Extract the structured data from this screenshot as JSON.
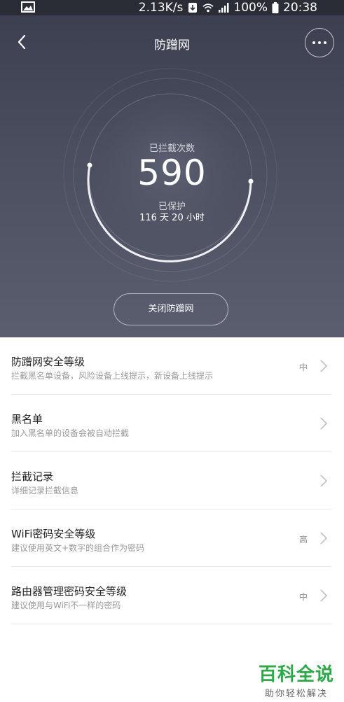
{
  "status_bar": {
    "network_speed": "2.13K/s",
    "battery": "100%",
    "time": "20:38",
    "icons": [
      "image-icon",
      "download-icon",
      "wifi-icon",
      "signal-icon",
      "battery-icon"
    ]
  },
  "header": {
    "title": "防蹭网",
    "back_icon": "chevron-left-icon",
    "more_icon": "more-horizontal-icon"
  },
  "stats": {
    "blocked_label": "已拦截次数",
    "blocked_count": "590",
    "protected_label": "已保护",
    "protected_duration": "116 天 20 小时"
  },
  "actions": {
    "close_button": "关闭防蹭网"
  },
  "settings": [
    {
      "title": "防蹭网安全等级",
      "subtitle": "拦截黑名单设备，风险设备上线提示，新设备上线提示",
      "value": "中"
    },
    {
      "title": "黑名单",
      "subtitle": "加入黑名单的设备会被自动拦截",
      "value": ""
    },
    {
      "title": "拦截记录",
      "subtitle": "详细记录拦截信息",
      "value": ""
    },
    {
      "title": "WiFi密码安全等级",
      "subtitle": "建议使用英文+数字的组合作为密码",
      "value": "高"
    },
    {
      "title": "路由器管理密码安全等级",
      "subtitle": "建议使用与WiFi不一样的密码",
      "value": "中"
    }
  ],
  "watermark": {
    "logo": "百科全说",
    "subtitle": "助你轻松解决"
  },
  "colors": {
    "hero_top": "#3b3e4e",
    "hero_bottom": "#5a5e6f",
    "watermark_green": "#2fa84a"
  }
}
